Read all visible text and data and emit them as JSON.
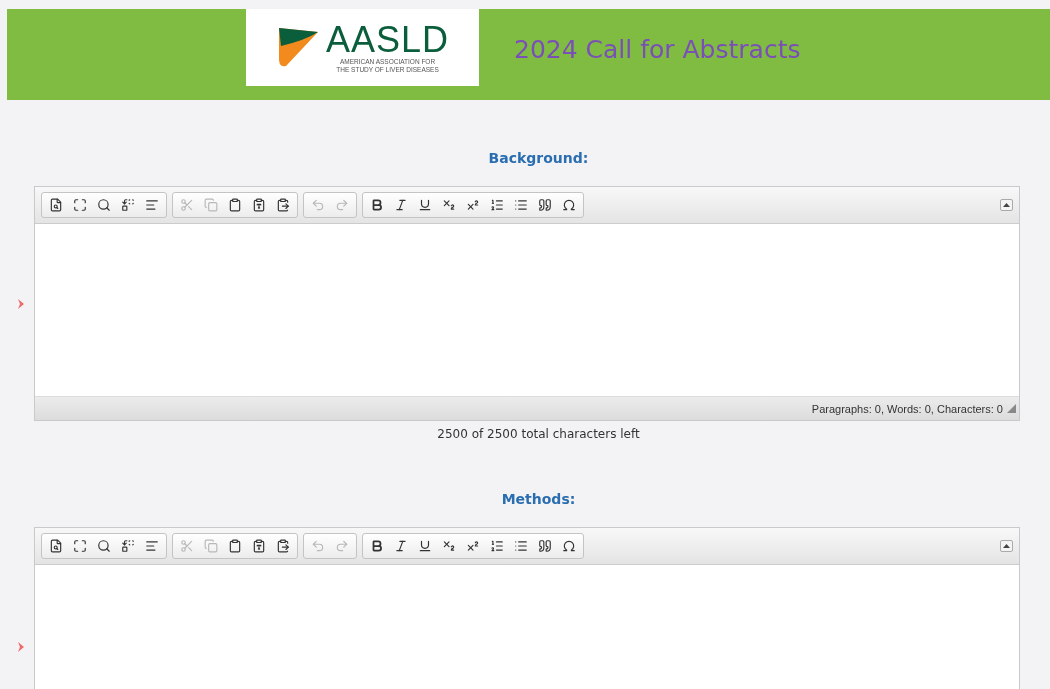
{
  "header": {
    "logo": {
      "acronym": "AASLD",
      "tagline": [
        "AMERICAN ASSOCIATION FOR",
        "THE STUDY OF LIVER DISEASES"
      ]
    },
    "title": "2024 Call for Abstracts"
  },
  "sections": [
    {
      "label": "Background:",
      "required": true,
      "status": "Paragraphs: 0, Words: 0, Characters: 0",
      "counter": "2500 of 2500 total characters left",
      "toolbar": [
        [
          {
            "kind": "preview",
            "disabled": false
          },
          {
            "kind": "maximize",
            "disabled": false
          },
          {
            "kind": "find",
            "disabled": false
          },
          {
            "kind": "replace",
            "disabled": false
          },
          {
            "kind": "template",
            "disabled": false
          }
        ],
        [
          {
            "kind": "cut",
            "disabled": true
          },
          {
            "kind": "copy",
            "disabled": true
          },
          {
            "kind": "paste",
            "disabled": false
          },
          {
            "kind": "paste-text",
            "disabled": false
          },
          {
            "kind": "paste-word",
            "disabled": false
          }
        ],
        [
          {
            "kind": "undo",
            "disabled": true
          },
          {
            "kind": "redo",
            "disabled": true
          }
        ],
        [
          {
            "kind": "bold",
            "disabled": false
          },
          {
            "kind": "italic",
            "disabled": false
          },
          {
            "kind": "underline",
            "disabled": false
          },
          {
            "kind": "subscript",
            "disabled": false
          },
          {
            "kind": "superscript",
            "disabled": false
          },
          {
            "kind": "numbered-list",
            "disabled": false
          },
          {
            "kind": "bulleted-list",
            "disabled": false
          },
          {
            "kind": "blockquote",
            "disabled": false
          },
          {
            "kind": "special-char",
            "disabled": false
          }
        ]
      ]
    },
    {
      "label": "Methods:",
      "required": true,
      "toolbar": [
        [
          {
            "kind": "preview",
            "disabled": false
          },
          {
            "kind": "maximize",
            "disabled": false
          },
          {
            "kind": "find",
            "disabled": false
          },
          {
            "kind": "replace",
            "disabled": false
          },
          {
            "kind": "template",
            "disabled": false
          }
        ],
        [
          {
            "kind": "cut",
            "disabled": true
          },
          {
            "kind": "copy",
            "disabled": true
          },
          {
            "kind": "paste",
            "disabled": false
          },
          {
            "kind": "paste-text",
            "disabled": false
          },
          {
            "kind": "paste-word",
            "disabled": false
          }
        ],
        [
          {
            "kind": "undo",
            "disabled": true
          },
          {
            "kind": "redo",
            "disabled": true
          }
        ],
        [
          {
            "kind": "bold",
            "disabled": false
          },
          {
            "kind": "italic",
            "disabled": false
          },
          {
            "kind": "underline",
            "disabled": false
          },
          {
            "kind": "subscript",
            "disabled": false
          },
          {
            "kind": "superscript",
            "disabled": false
          },
          {
            "kind": "numbered-list",
            "disabled": false
          },
          {
            "kind": "bulleted-list",
            "disabled": false
          },
          {
            "kind": "blockquote",
            "disabled": false
          },
          {
            "kind": "special-char",
            "disabled": false
          }
        ]
      ]
    }
  ]
}
